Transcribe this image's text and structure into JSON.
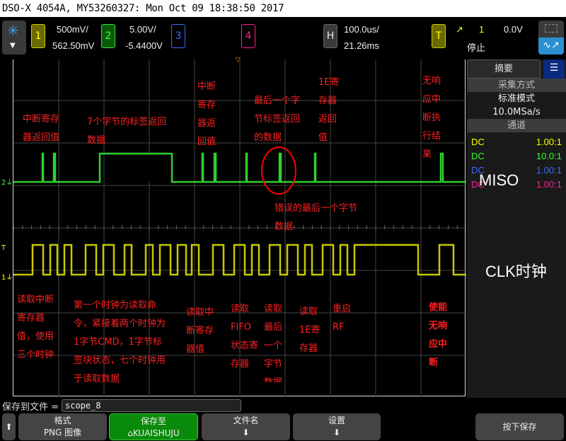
{
  "title": "DSO-X 4054A, MY53260327: Mon Oct 09 18:38:50 2017",
  "channels": [
    {
      "num": "1",
      "scale": "500mV/",
      "offset": "562.50mV",
      "color": "#c8c800",
      "coupling": "DC",
      "probe": "1.00:1"
    },
    {
      "num": "2",
      "scale": "5.00V/",
      "offset": "-5.4400V",
      "color": "#30d030",
      "coupling": "DC",
      "probe": "10.0:1"
    },
    {
      "num": "3",
      "color": "#3a6cff",
      "coupling": "DC",
      "probe": "1.00:1"
    },
    {
      "num": "4",
      "color": "#ff2090",
      "coupling": "DC",
      "probe": "1.00:1"
    }
  ],
  "horizontal": {
    "label": "H",
    "scale": "100.0us/",
    "delay": "21.26ms"
  },
  "trigger": {
    "label": "T",
    "source": "1",
    "level": "0.0V",
    "status": "停止"
  },
  "side": {
    "tab": "摘要",
    "acq_header": "采集方式",
    "acq_mode": "标准模式",
    "sample_rate": "10.0MSa/s",
    "ch_header": "通道"
  },
  "labels": {
    "miso": "MISO",
    "clk": "CLK时钟"
  },
  "annotations": {
    "g1": "中断寄存\n器返回值",
    "g2": "7个字节的标签返回\n数据",
    "g3": "中断\n寄存\n器返\n回值",
    "g4": "最后一个字\n节标签返回\n的数据",
    "g5": "1E寄\n存器\n返回\n值",
    "g6": "无响\n应中\n断执\n行结\n果",
    "g7": "错误的最后一个字节\n数据",
    "y1": "读取中断\n寄存器\n值，使用\n三个时钟",
    "y2": "第一个时钟为读取命\n令，紧接着两个时钟为\n1字节CMD，1字节标\n签块状态，七个时钟用\n于读取数据",
    "y3": "读取中\n断寄存\n器值",
    "y4": "读取\nFIFO\n状态寄\n存器",
    "y5": "读取\n最后\n一个\n字节\n数据",
    "y6": "读取\n1E寄\n存器",
    "y7": "重启\nRF",
    "y8": "使能\n无响\n应中\n断"
  },
  "save": {
    "label": "保存到文件 =",
    "filename": "scope_8"
  },
  "softkeys": [
    {
      "title": "格式",
      "value": "PNG 图像"
    },
    {
      "title": "保存至",
      "value": "⌂KUAISHUJU"
    },
    {
      "title": "文件名",
      "value": "⬇"
    },
    {
      "title": "设置",
      "value": "⬇"
    },
    {
      "title": "按下保存",
      "value": ""
    }
  ]
}
